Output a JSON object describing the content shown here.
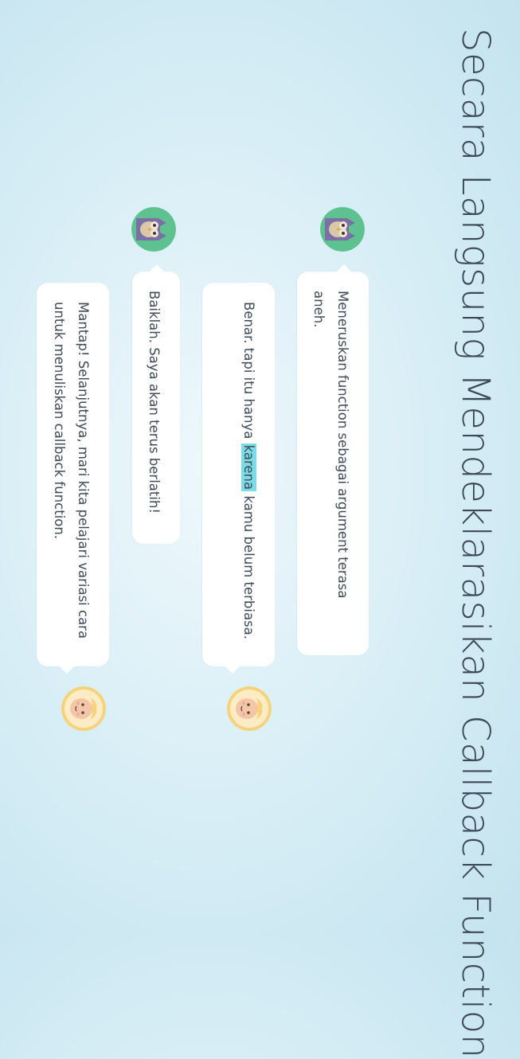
{
  "page": {
    "title": "Secara Langsung Mendeklarasikan Callback Function"
  },
  "colors": {
    "background": "#d6edf5",
    "bubble": "#ffffff",
    "text": "#3f4a55",
    "highlight": "#7bdbe8",
    "owl_ring": "#5dc28f",
    "owl_body": "#7b6fa6",
    "sheep_ring": "#f6d27a"
  },
  "messages": [
    {
      "speaker": "owl",
      "avatar_icon": "owl-avatar-icon",
      "text": "Meneruskan function sebagai argument terasa aneh."
    },
    {
      "speaker": "sheep",
      "avatar_icon": "sheep-avatar-icon",
      "text_before": "Benar. tapi itu hanya ",
      "highlight": "karena",
      "text_after": " kamu belum terbiasa."
    },
    {
      "speaker": "owl",
      "avatar_icon": "owl-avatar-icon",
      "text": "Baiklah. Saya akan terus berlatih!"
    },
    {
      "speaker": "sheep",
      "avatar_icon": "sheep-avatar-icon",
      "text": "Mantap! Selanjutnya, mari kita pelajari variasi cara untuk menuliskan callback function."
    }
  ]
}
